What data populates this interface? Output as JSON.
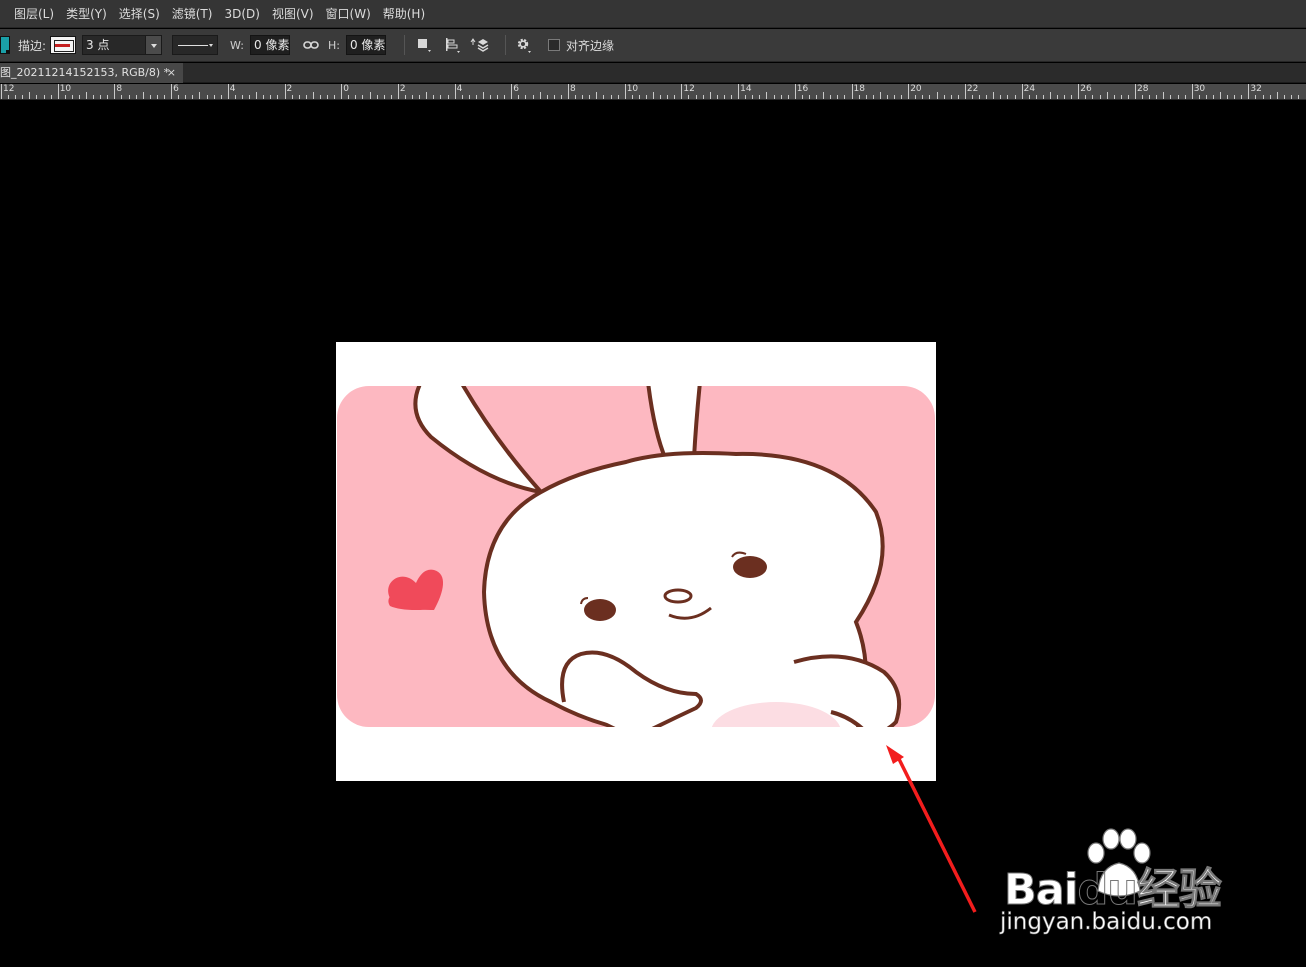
{
  "menu": {
    "items": [
      {
        "label": "图层(L)"
      },
      {
        "label": "类型(Y)"
      },
      {
        "label": "选择(S)"
      },
      {
        "label": "滤镜(T)"
      },
      {
        "label": "3D(D)"
      },
      {
        "label": "视图(V)"
      },
      {
        "label": "窗口(W)"
      },
      {
        "label": "帮助(H)"
      }
    ]
  },
  "options": {
    "fill_color": "#1aa0a8",
    "stroke_label": "描边:",
    "stroke_color": "#c31e1e",
    "stroke_size": "3 点",
    "w_label": "W:",
    "w_value": "0 像素",
    "h_label": "H:",
    "h_value": "0 像素",
    "align_edges_label": "对齐边缘",
    "align_edges_checked": false,
    "icons": [
      "path-operations-icon",
      "path-alignment-icon",
      "path-arrangement-icon",
      "gear-icon",
      "link-icon"
    ]
  },
  "document_tab": {
    "title": "图_20211214152153, RGB/8) *",
    "close_label": "×"
  },
  "ruler": {
    "labels": [
      "12",
      "10",
      "8",
      "6",
      "4",
      "2",
      "0",
      "2",
      "4",
      "6",
      "8",
      "10",
      "12",
      "14",
      "16",
      "18",
      "20",
      "22",
      "24",
      "26",
      "28",
      "30",
      "32"
    ]
  },
  "canvas": {
    "background": "#000000",
    "artboard_color": "#ffffff",
    "image_background": "#fdb8c1"
  },
  "annotation": {
    "arrow_color": "#f21d1d"
  },
  "watermark": {
    "logo_text": "Bai",
    "logo_text_2": "du",
    "logo_cn": "经验",
    "url": "jingyan.baidu.com"
  }
}
